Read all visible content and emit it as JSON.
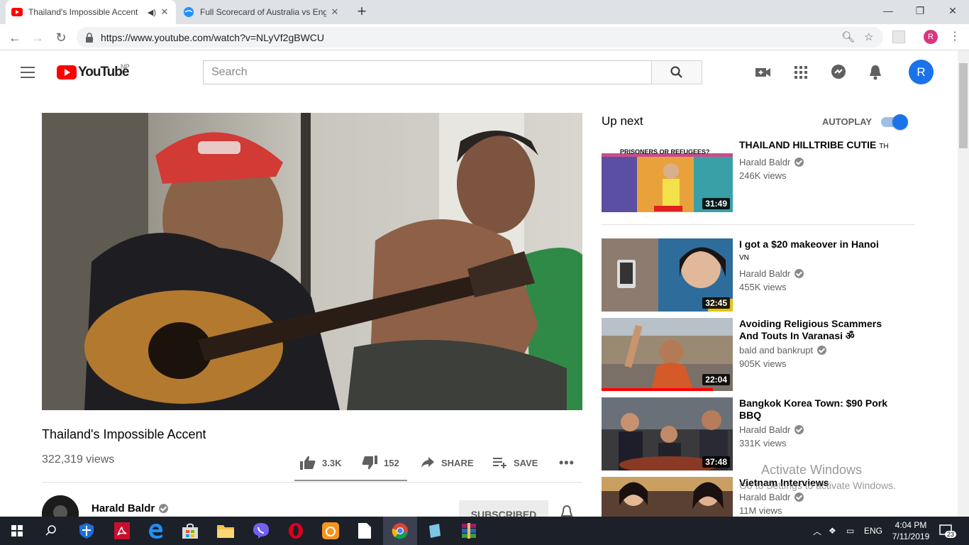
{
  "browser": {
    "tabs": [
      {
        "title": "Thailand's Impossible Accent",
        "active": true,
        "icon": "youtube-favicon"
      },
      {
        "title": "Full Scorecard of Australia vs Eng",
        "active": false,
        "icon": "globe-favicon"
      }
    ],
    "url": "https://www.youtube.com/watch?v=NLyVf2gBWCU",
    "profile_initial": "R"
  },
  "youtube": {
    "logo_text": "YouTube",
    "country_code": "NP",
    "search_placeholder": "Search",
    "avatar_initial": "R"
  },
  "video": {
    "title": "Thailand's Impossible Accent",
    "views": "322,319 views",
    "likes": "3.3K",
    "dislikes": "152",
    "share_label": "SHARE",
    "save_label": "SAVE",
    "like_ratio": 0.956,
    "channel": "Harald Baldr",
    "subscribe_label": "SUBSCRIBED"
  },
  "upnext": {
    "heading": "Up next",
    "autoplay_label": "AUTOPLAY",
    "autoplay_on": true,
    "items": [
      {
        "title": "THAILAND HILLTRIBE CUTIE",
        "tag": "TH",
        "channel": "Harald Baldr",
        "views": "246K views",
        "duration": "31:49",
        "thumb_caption": "PRISONERS OR REFUGEES?"
      },
      {
        "title": "I got a $20 makeover in Hanoi",
        "tag": "VN",
        "channel": "Harald Baldr",
        "views": "455K views",
        "duration": "32:45"
      },
      {
        "title": "Avoiding Religious Scammers And Touts In Varanasi ॐ",
        "tag": "",
        "channel": "bald and bankrupt",
        "views": "905K views",
        "duration": "22:04",
        "watched_fraction": 0.85
      },
      {
        "title": "Bangkok Korea Town: $90 Pork BBQ",
        "tag": "",
        "channel": "Harald Baldr",
        "views": "331K views",
        "duration": "37:48"
      },
      {
        "title": "Vietnam Interviews",
        "tag": "",
        "channel": "Harald Baldr",
        "views": "11M views",
        "duration": ""
      }
    ]
  },
  "watermark": {
    "line1": "Activate Windows",
    "line2": "Go to Settings to activate Windows."
  },
  "taskbar": {
    "language": "ENG",
    "time": "4:04 PM",
    "date": "7/11/2019",
    "notification_count": "23"
  }
}
